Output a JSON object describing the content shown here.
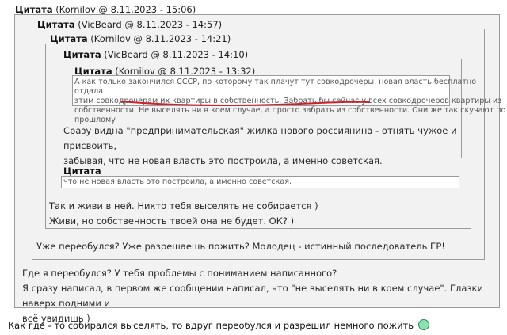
{
  "quote_label": "Цитата",
  "q1": {
    "meta": "(Kornilov @ 8.11.2023 - 15:06)"
  },
  "q2": {
    "meta": "(VicBeard @ 8.11.2023 - 14:57)"
  },
  "q3": {
    "meta": "(Kornilov @ 8.11.2023 - 14:21)"
  },
  "q4": {
    "meta": "(VicBeard @ 8.11.2023 - 14:10)"
  },
  "q5": {
    "meta": "(Kornilov @ 8.11.2023 - 13:32)",
    "lines": [
      "А как только закончился СССР, по которому так плачут тут совкодрочеры, новая власть бесплатно отдала",
      "этим совкодрочерам их квартиры в собственность. Забрать бы сейчас у всех совкодрочеров квартиры из",
      "собственности. Не выселять ни в коем случае, а просто забрать из собственности. Они же так скучают по",
      "прошлому"
    ]
  },
  "q4_text": [
    "Сразу видна \"предпринимательская\" жилка нового россиянина - отнять чужое и присвоить,",
    "забывая, что не новая власть это построила, а именно советская."
  ],
  "q6": {
    "text": "что не новая власть это построила, а именно советская."
  },
  "q3_text": [
    "Так и живи в ней. Никто тебя выселять не собирается )",
    "Живи, но собственность твоей она не будет. ОК? )"
  ],
  "q2_text": "Уже переобулся? Уже разрешаешь пожить? Молодец - истинный последователь ЕР!",
  "q1_text": [
    "Где я переобулся? У тебя проблемы с пониманием написанного?",
    "Я сразу написал, в первом же сообщении написал, что \"не выселять ни в коем случае\". Глазки наверх подними и",
    "всё увидишь )"
  ],
  "reply_text": "Как где - то собирался выселять, то вдруг переобулся и разрешил немного пожить",
  "colors": {
    "underline": "#d0202a",
    "smiley": "#8ee0b0"
  }
}
